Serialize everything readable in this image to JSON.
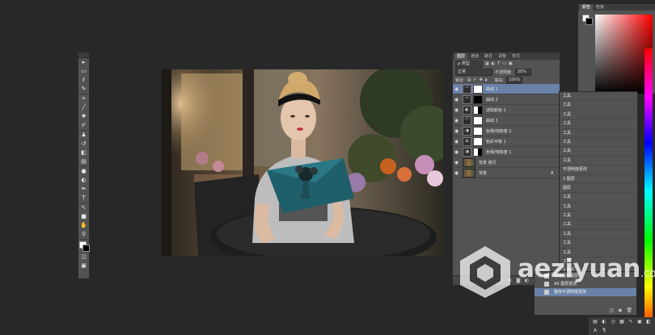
{
  "toolbar": {
    "tools": [
      {
        "name": "move-icon",
        "glyph": "▸"
      },
      {
        "name": "marquee-icon",
        "glyph": "▭"
      },
      {
        "name": "lasso-icon",
        "glyph": "ℓ"
      },
      {
        "name": "quick-select-icon",
        "glyph": "✎"
      },
      {
        "name": "crop-icon",
        "glyph": "⌗"
      },
      {
        "name": "eyedropper-icon",
        "glyph": "╱"
      },
      {
        "name": "healing-icon",
        "glyph": "✚"
      },
      {
        "name": "brush-icon",
        "glyph": "✐"
      },
      {
        "name": "stamp-icon",
        "glyph": "♟"
      },
      {
        "name": "history-brush-icon",
        "glyph": "↺"
      },
      {
        "name": "eraser-icon",
        "glyph": "◧"
      },
      {
        "name": "gradient-icon",
        "glyph": "▤"
      },
      {
        "name": "blur-icon",
        "glyph": "●"
      },
      {
        "name": "dodge-icon",
        "glyph": "◐"
      },
      {
        "name": "pen-icon",
        "glyph": "✒"
      },
      {
        "name": "type-icon",
        "glyph": "T"
      },
      {
        "name": "path-select-icon",
        "glyph": "↖"
      },
      {
        "name": "shape-icon",
        "glyph": "■"
      },
      {
        "name": "hand-icon",
        "glyph": "✋"
      },
      {
        "name": "zoom-icon",
        "glyph": "⚲"
      }
    ]
  },
  "layers_panel": {
    "tabs": [
      "图层",
      "通道",
      "路径",
      "调整",
      "样式"
    ],
    "filter_label": "ρ 类型",
    "blend_mode": "正常",
    "opacity_label": "不透明度:",
    "opacity_value": "30%",
    "lock_label": "锁定:",
    "fill_label": "填充:",
    "fill_value": "100%",
    "layers": [
      {
        "name": "曲线 1",
        "thumb": "curves",
        "mask": "white",
        "selected": true
      },
      {
        "name": "曲线 2",
        "thumb": "curves",
        "mask": "dark",
        "selected": false
      },
      {
        "name": "选取颜色 1",
        "thumb": "selective",
        "mask": "half",
        "selected": false
      },
      {
        "name": "曲线 1",
        "thumb": "curves",
        "mask": "white",
        "selected": false
      },
      {
        "name": "色相/饱和度 2",
        "thumb": "hue",
        "mask": "white",
        "selected": false
      },
      {
        "name": "色彩平衡 1",
        "thumb": "balance",
        "mask": "white",
        "selected": false
      },
      {
        "name": "色相/饱和度 1",
        "thumb": "hue",
        "mask": "half",
        "selected": false
      },
      {
        "name": "背景 拷贝",
        "thumb": "image",
        "mask": "none",
        "selected": false
      },
      {
        "name": "背景",
        "thumb": "image",
        "mask": "none",
        "selected": false
      }
    ]
  },
  "color_panel": {
    "tabs": [
      "颜色",
      "色板"
    ]
  },
  "history_panel": {
    "items": [
      "工具",
      "工具",
      "工具",
      "工具",
      "工具",
      "工具",
      "工具",
      "工具",
      "不透明度更改",
      "2 图层",
      "图层",
      "工具",
      "工具",
      "工具",
      "工具",
      "工具",
      "工具",
      "工具",
      "工具",
      "3 选区",
      "工具"
    ]
  },
  "history_panel_2": {
    "items": [
      "取消组合图层",
      "Alt 图层更改",
      "整体不透明度更改"
    ],
    "selected_index": 2
  },
  "watermark": {
    "text": "aeziyuan",
    "domain": ".com"
  }
}
